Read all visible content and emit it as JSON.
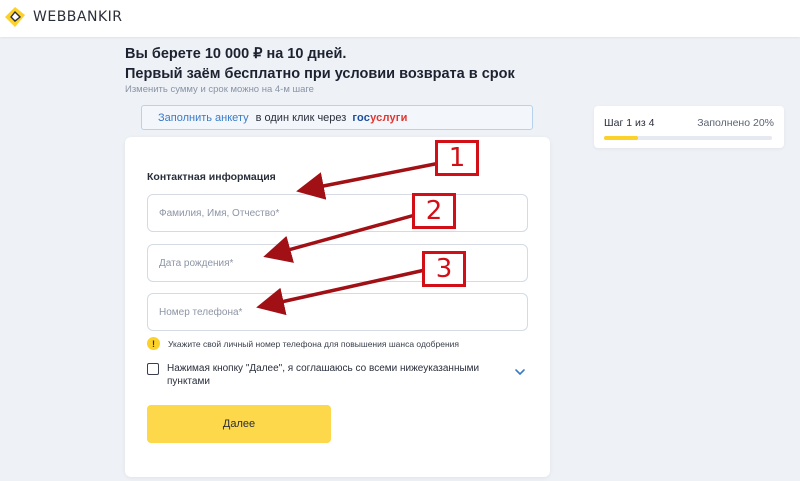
{
  "brand": {
    "name": "WEBBANKIR"
  },
  "offer": {
    "line1": "Вы берете 10 000 ₽ на 10 дней.",
    "line2": "Первый заём бесплатно при условии возврата в срок",
    "note": "Изменить сумму и срок можно на 4-м шаге"
  },
  "gosuslugi": {
    "link": "Заполнить анкету",
    "middle": "в один клик через",
    "logo_a": "гос",
    "logo_b": "услуги"
  },
  "progress": {
    "step": "Шаг 1 из 4",
    "filled": "Заполнено 20%",
    "percent": 20
  },
  "form": {
    "section_title": "Контактная информация",
    "fields": [
      {
        "placeholder": "Фамилия, Имя, Отчество*",
        "value": ""
      },
      {
        "placeholder": "Дата рождения*",
        "value": ""
      },
      {
        "placeholder": "Номер телефона*",
        "value": ""
      }
    ],
    "hint": "Укажите свой личный номер телефона для повышения шанса одобрения",
    "agree": "Нажимая кнопку \"Далее\", я соглашаюсь со всеми нижеуказанными пунктами",
    "submit": "Далее"
  },
  "annotations": [
    "1",
    "2",
    "3"
  ],
  "colors": {
    "accent": "#fcd84a",
    "link": "#3a7bc8",
    "annotation": "#d20f17"
  }
}
